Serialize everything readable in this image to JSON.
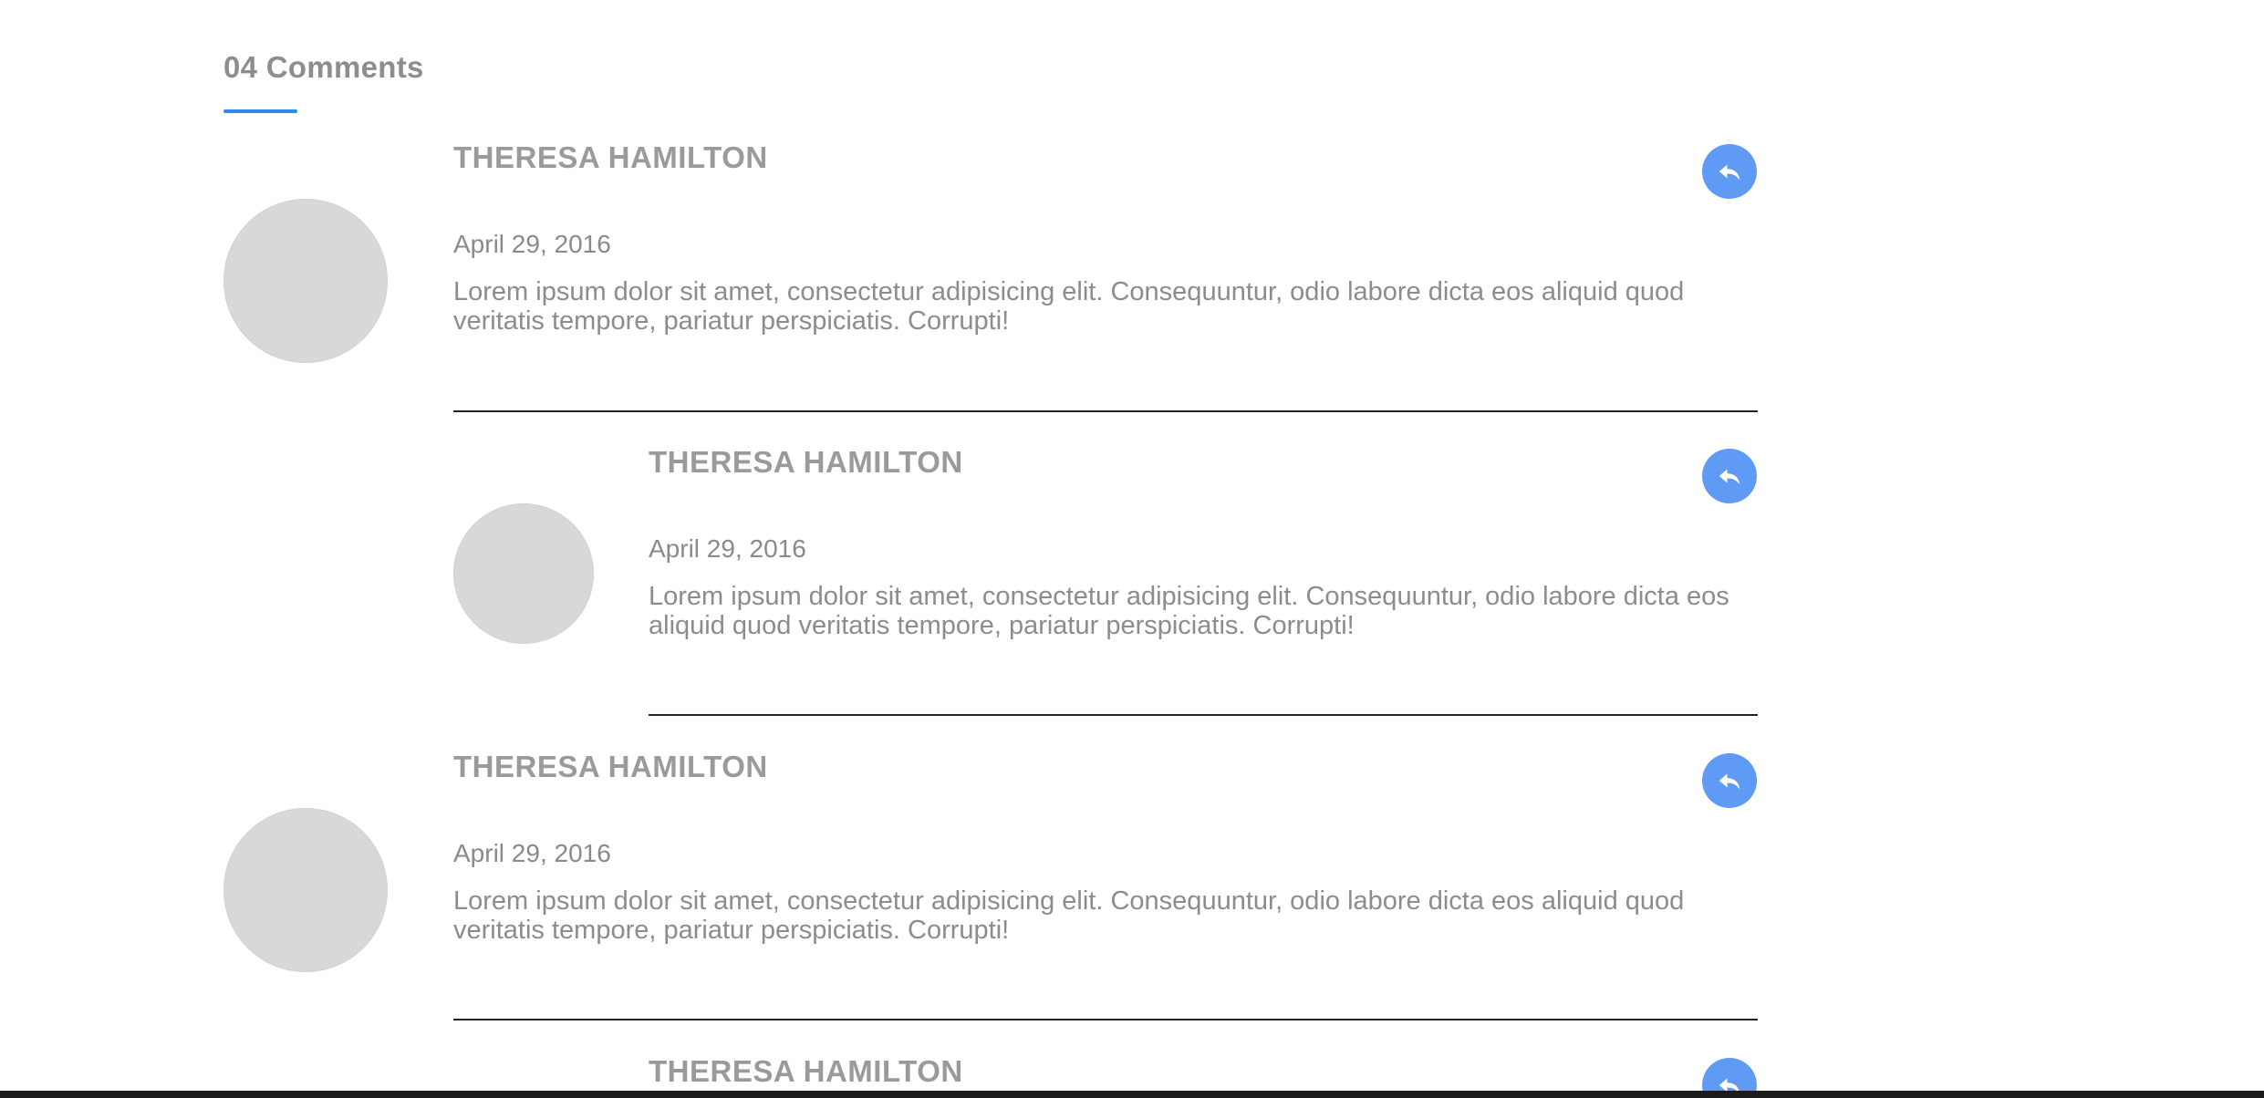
{
  "comments_section": {
    "title": "04 Comments",
    "accent_color": "#2c8ee8",
    "reply_icon": "reply-icon",
    "reply_color": "#5f9bf4"
  },
  "comments": [
    {
      "author": "THERESA HAMILTON",
      "date": "April 29, 2016",
      "text": "Lorem ipsum dolor sit amet, consectetur adipisicing elit. Consequuntur, odio labore dicta eos aliquid quod veritatis tempore, pariatur perspiciatis. Corrupti!",
      "nested": false
    },
    {
      "author": "THERESA HAMILTON",
      "date": "April 29, 2016",
      "text": "Lorem ipsum dolor sit amet, consectetur adipisicing elit. Consequuntur, odio labore dicta eos aliquid quod veritatis tempore, pariatur perspiciatis. Corrupti!",
      "nested": true
    },
    {
      "author": "THERESA HAMILTON",
      "date": "April 29, 2016",
      "text": "Lorem ipsum dolor sit amet, consectetur adipisicing elit. Consequuntur, odio labore dicta eos aliquid quod veritatis tempore, pariatur perspiciatis. Corrupti!",
      "nested": false
    },
    {
      "author": "THERESA HAMILTON",
      "nested": true
    }
  ]
}
